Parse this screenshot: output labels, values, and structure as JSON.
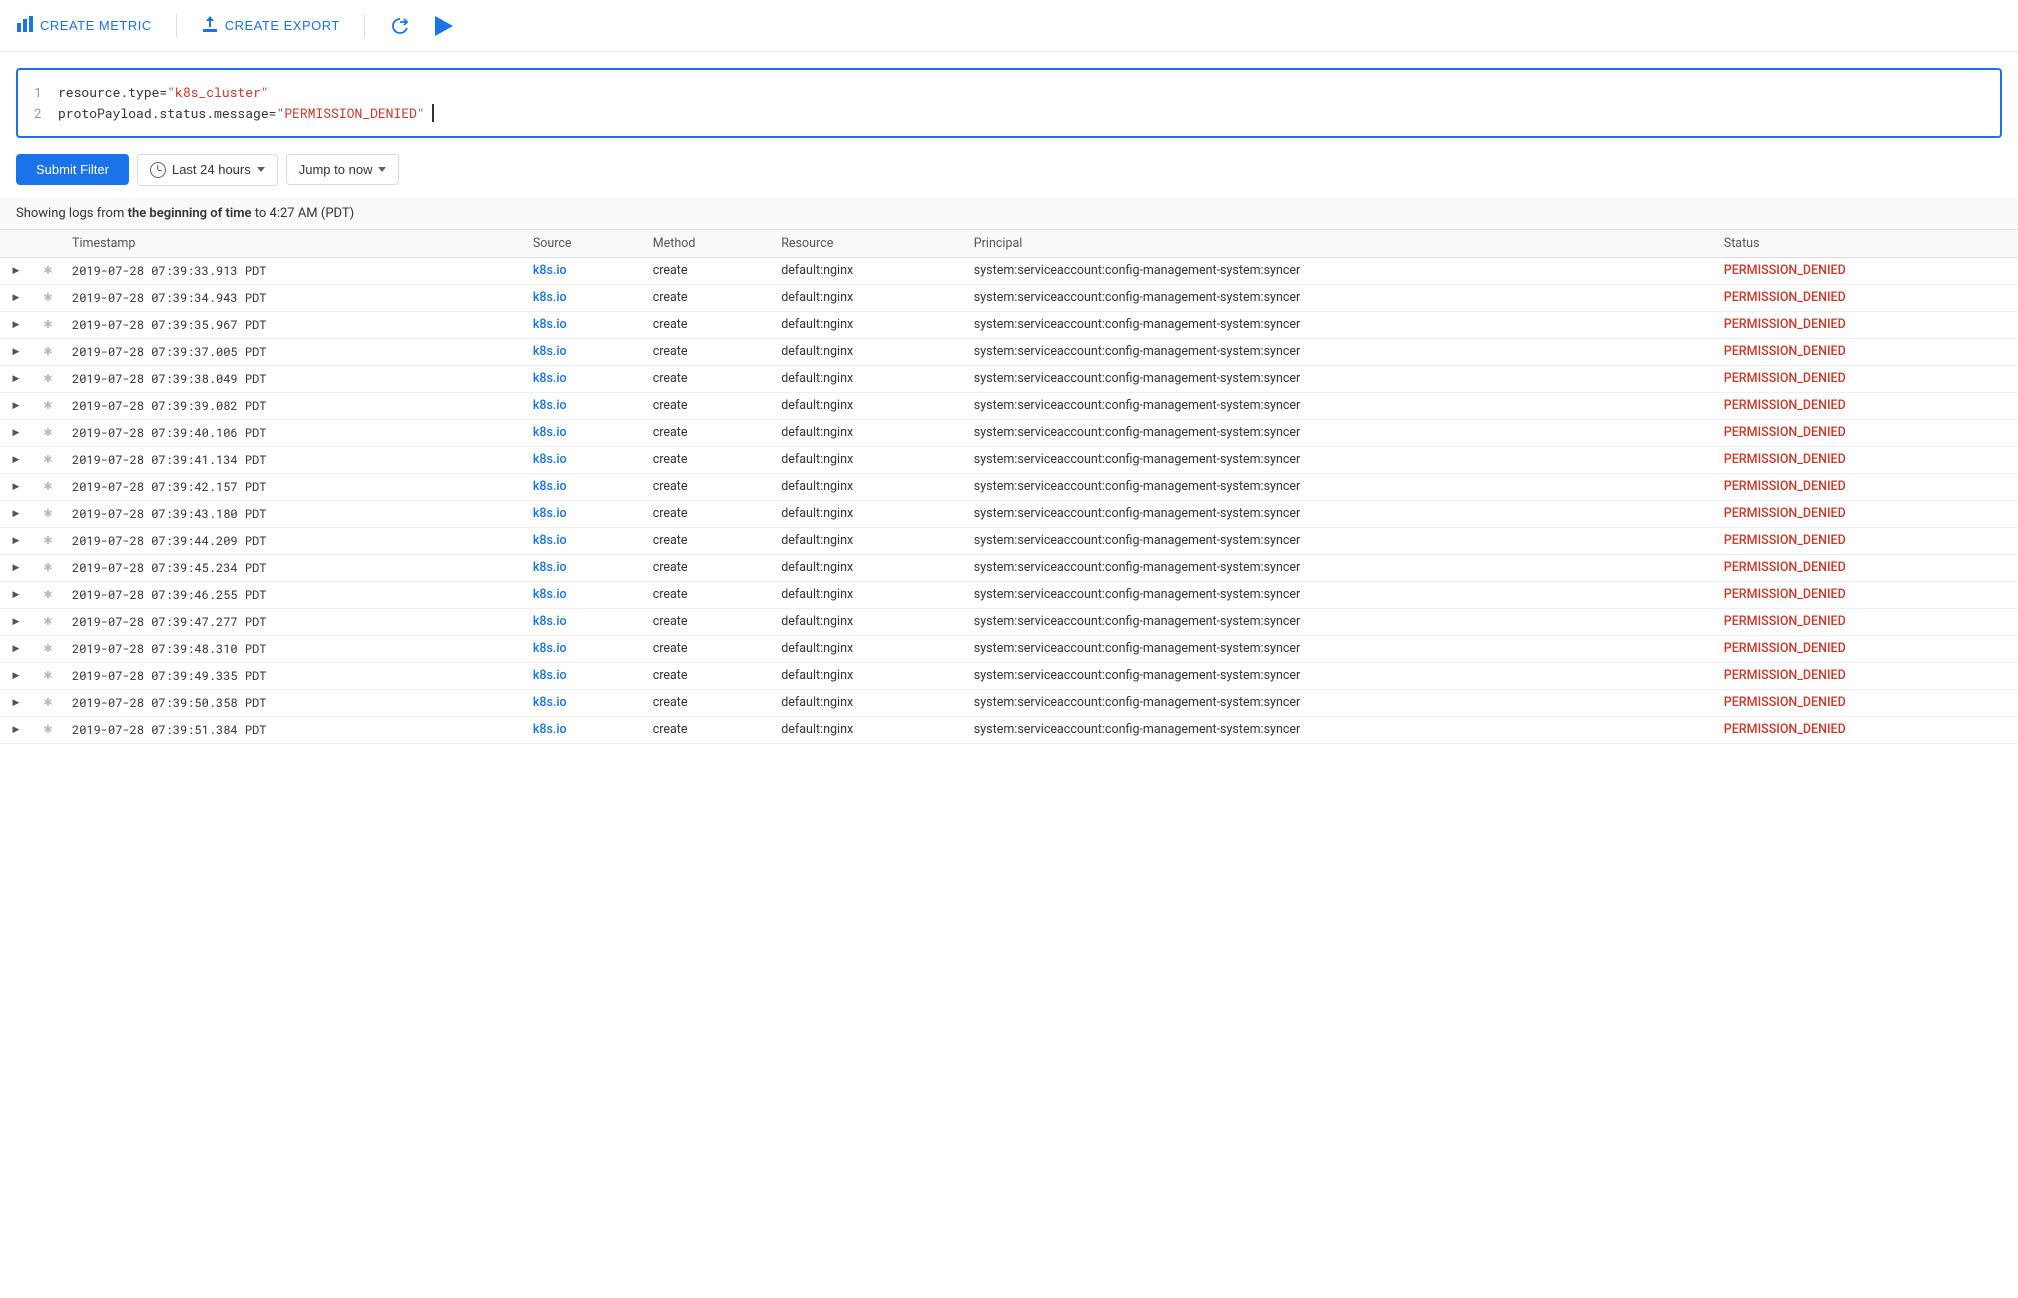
{
  "toolbar": {
    "create_metric_label": "CREATE METRIC",
    "create_export_label": "CREATE EXPORT"
  },
  "query": {
    "line1_key": "resource.type=",
    "line1_value": "\"k8s_cluster\"",
    "line2_key": "protoPayload.status.message=",
    "line2_value": "\"PERMISSION_DENIED\""
  },
  "filter": {
    "submit_label": "Submit Filter",
    "time_range_label": "Last 24 hours",
    "jump_label": "Jump to now"
  },
  "logs_info": {
    "prefix": "Showing logs from ",
    "bold_text": "the beginning of time",
    "suffix": " to 4:27 AM (PDT)"
  },
  "table": {
    "columns": [
      "",
      "",
      "Timestamp",
      "Source",
      "Method",
      "Resource",
      "Principal",
      "Status"
    ],
    "rows": [
      {
        "timestamp": "2019-07-28 07:39:33.913 PDT",
        "source": "k8s.io",
        "method": "create",
        "resource": "default:nginx",
        "principal": "system:serviceaccount:config-management-system:syncer",
        "status": "PERMISSION_DENIED"
      },
      {
        "timestamp": "2019-07-28 07:39:34.943 PDT",
        "source": "k8s.io",
        "method": "create",
        "resource": "default:nginx",
        "principal": "system:serviceaccount:config-management-system:syncer",
        "status": "PERMISSION_DENIED"
      },
      {
        "timestamp": "2019-07-28 07:39:35.967 PDT",
        "source": "k8s.io",
        "method": "create",
        "resource": "default:nginx",
        "principal": "system:serviceaccount:config-management-system:syncer",
        "status": "PERMISSION_DENIED"
      },
      {
        "timestamp": "2019-07-28 07:39:37.005 PDT",
        "source": "k8s.io",
        "method": "create",
        "resource": "default:nginx",
        "principal": "system:serviceaccount:config-management-system:syncer",
        "status": "PERMISSION_DENIED"
      },
      {
        "timestamp": "2019-07-28 07:39:38.049 PDT",
        "source": "k8s.io",
        "method": "create",
        "resource": "default:nginx",
        "principal": "system:serviceaccount:config-management-system:syncer",
        "status": "PERMISSION_DENIED"
      },
      {
        "timestamp": "2019-07-28 07:39:39.082 PDT",
        "source": "k8s.io",
        "method": "create",
        "resource": "default:nginx",
        "principal": "system:serviceaccount:config-management-system:syncer",
        "status": "PERMISSION_DENIED"
      },
      {
        "timestamp": "2019-07-28 07:39:40.106 PDT",
        "source": "k8s.io",
        "method": "create",
        "resource": "default:nginx",
        "principal": "system:serviceaccount:config-management-system:syncer",
        "status": "PERMISSION_DENIED"
      },
      {
        "timestamp": "2019-07-28 07:39:41.134 PDT",
        "source": "k8s.io",
        "method": "create",
        "resource": "default:nginx",
        "principal": "system:serviceaccount:config-management-system:syncer",
        "status": "PERMISSION_DENIED"
      },
      {
        "timestamp": "2019-07-28 07:39:42.157 PDT",
        "source": "k8s.io",
        "method": "create",
        "resource": "default:nginx",
        "principal": "system:serviceaccount:config-management-system:syncer",
        "status": "PERMISSION_DENIED"
      },
      {
        "timestamp": "2019-07-28 07:39:43.180 PDT",
        "source": "k8s.io",
        "method": "create",
        "resource": "default:nginx",
        "principal": "system:serviceaccount:config-management-system:syncer",
        "status": "PERMISSION_DENIED"
      },
      {
        "timestamp": "2019-07-28 07:39:44.209 PDT",
        "source": "k8s.io",
        "method": "create",
        "resource": "default:nginx",
        "principal": "system:serviceaccount:config-management-system:syncer",
        "status": "PERMISSION_DENIED"
      },
      {
        "timestamp": "2019-07-28 07:39:45.234 PDT",
        "source": "k8s.io",
        "method": "create",
        "resource": "default:nginx",
        "principal": "system:serviceaccount:config-management-system:syncer",
        "status": "PERMISSION_DENIED"
      },
      {
        "timestamp": "2019-07-28 07:39:46.255 PDT",
        "source": "k8s.io",
        "method": "create",
        "resource": "default:nginx",
        "principal": "system:serviceaccount:config-management-system:syncer",
        "status": "PERMISSION_DENIED"
      },
      {
        "timestamp": "2019-07-28 07:39:47.277 PDT",
        "source": "k8s.io",
        "method": "create",
        "resource": "default:nginx",
        "principal": "system:serviceaccount:config-management-system:syncer",
        "status": "PERMISSION_DENIED"
      },
      {
        "timestamp": "2019-07-28 07:39:48.310 PDT",
        "source": "k8s.io",
        "method": "create",
        "resource": "default:nginx",
        "principal": "system:serviceaccount:config-management-system:syncer",
        "status": "PERMISSION_DENIED"
      },
      {
        "timestamp": "2019-07-28 07:39:49.335 PDT",
        "source": "k8s.io",
        "method": "create",
        "resource": "default:nginx",
        "principal": "system:serviceaccount:config-management-system:syncer",
        "status": "PERMISSION_DENIED"
      },
      {
        "timestamp": "2019-07-28 07:39:50.358 PDT",
        "source": "k8s.io",
        "method": "create",
        "resource": "default:nginx",
        "principal": "system:serviceaccount:config-management-system:syncer",
        "status": "PERMISSION_DENIED"
      },
      {
        "timestamp": "2019-07-28 07:39:51.384 PDT",
        "source": "k8s.io",
        "method": "create",
        "resource": "default:nginx",
        "principal": "system:serviceaccount:config-management-system:syncer",
        "status": "PERMISSION_DENIED"
      }
    ]
  }
}
